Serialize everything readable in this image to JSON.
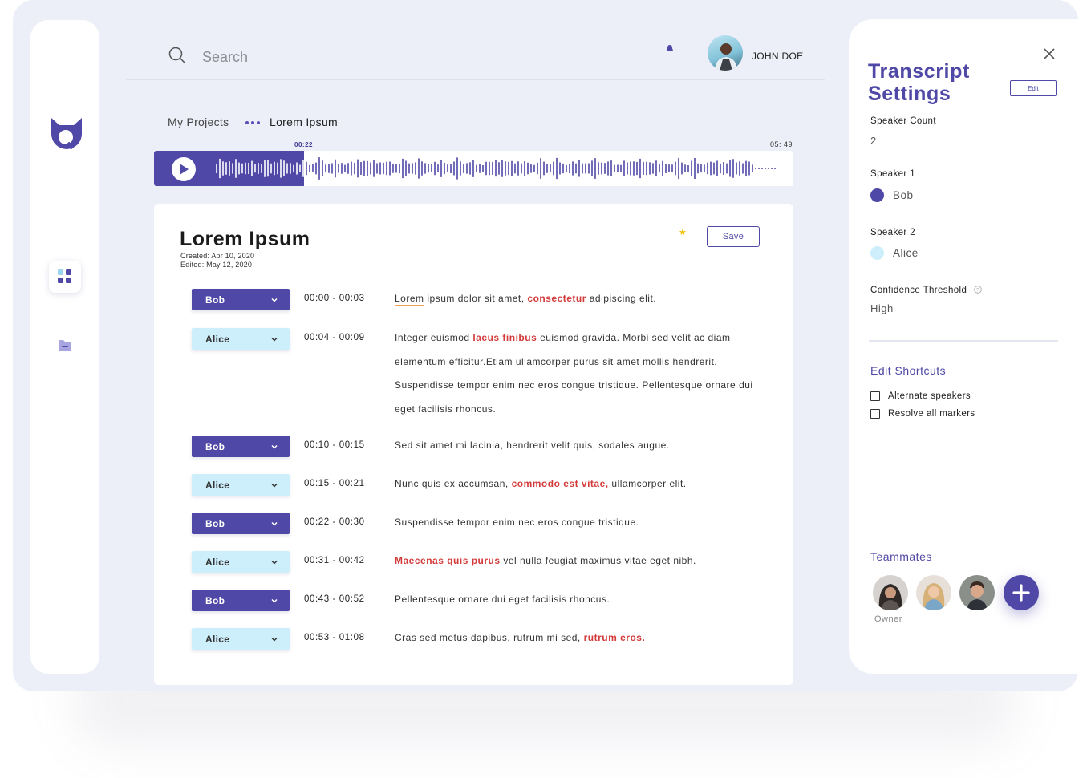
{
  "search": {
    "placeholder": "Search"
  },
  "user": {
    "name": "JOHN DOE"
  },
  "breadcrumb": {
    "parent": "My Projects",
    "current": "Lorem Ipsum"
  },
  "player": {
    "current_time": "00:22",
    "total_time": "05: 49",
    "progress": 0.235
  },
  "document": {
    "title": "Lorem Ipsum",
    "created": "Created: Apr 10, 2020",
    "edited": "Edited: May 12, 2020",
    "save_label": "Save"
  },
  "segments": [
    {
      "speaker": "Bob",
      "time": "00:00 - 00:03",
      "parts": [
        {
          "t": "Lorem",
          "s": "ul"
        },
        {
          "t": " ipsum dolor sit amet, "
        },
        {
          "t": "consectetur",
          "s": "hl"
        },
        {
          "t": " adipiscing elit."
        }
      ]
    },
    {
      "speaker": "Alice",
      "time": "00:04 - 00:09",
      "parts": [
        {
          "t": "Integer euismod "
        },
        {
          "t": "lacus finibus",
          "s": "hl"
        },
        {
          "t": " euismod gravida. Morbi sed velit ac diam elementum efficitur.Etiam ullamcorper purus sit amet mollis hendrerit. Suspendisse tempor enim nec eros congue tristique. Pellentesque ornare dui eget facilisis rhoncus."
        }
      ]
    },
    {
      "speaker": "Bob",
      "time": "00:10 - 00:15",
      "parts": [
        {
          "t": "Sed sit amet mi lacinia, hendrerit velit quis, sodales augue."
        }
      ]
    },
    {
      "speaker": "Alice",
      "time": "00:15 - 00:21",
      "parts": [
        {
          "t": "Nunc quis ex accumsan, "
        },
        {
          "t": "commodo est vitae,",
          "s": "hl"
        },
        {
          "t": " ullamcorper elit."
        }
      ]
    },
    {
      "speaker": "Bob",
      "time": "00:22 - 00:30",
      "parts": [
        {
          "t": "Suspendisse tempor enim nec eros congue tristique."
        }
      ]
    },
    {
      "speaker": "Alice",
      "time": "00:31 - 00:42",
      "parts": [
        {
          "t": "Maecenas quis purus",
          "s": "hl"
        },
        {
          "t": " vel nulla feugiat maximus vitae eget nibh."
        }
      ]
    },
    {
      "speaker": "Bob",
      "time": "00:43 - 00:52",
      "parts": [
        {
          "t": "Pellentesque ornare dui eget facilisis rhoncus."
        }
      ]
    },
    {
      "speaker": "Alice",
      "time": "00:53 - 01:08",
      "parts": [
        {
          "t": "Cras sed metus dapibus, rutrum mi sed, "
        },
        {
          "t": "rutrum eros.",
          "s": "hl"
        }
      ]
    }
  ],
  "settings": {
    "title_line1": "Transcript",
    "title_line2": "Settings",
    "edit_label": "Edit",
    "speaker_count_label": "Speaker Count",
    "speaker_count_value": "2",
    "speaker1_label": "Speaker 1",
    "speaker1_name": "Bob",
    "speaker2_label": "Speaker 2",
    "speaker2_name": "Alice",
    "confidence_label": "Confidence Threshold",
    "confidence_value": "High",
    "shortcuts_heading": "Edit Shortcuts",
    "shortcuts": [
      {
        "label": "Alternate speakers",
        "checked": false
      },
      {
        "label": "Resolve all markers",
        "checked": false
      }
    ],
    "teammates_heading": "Teammates",
    "owner_label": "Owner"
  },
  "colors": {
    "brand": "#4f48a6",
    "speaker1": "#4f48a6",
    "speaker2": "#cdeefb",
    "highlight": "#d33a3a",
    "background": "#eceef8"
  },
  "icons": [
    "search-icon",
    "bell-icon",
    "logo-icon",
    "dashboard-icon",
    "folder-icon",
    "play-icon",
    "chevron-down-icon",
    "star-icon",
    "close-icon",
    "help-icon",
    "plus-icon"
  ]
}
